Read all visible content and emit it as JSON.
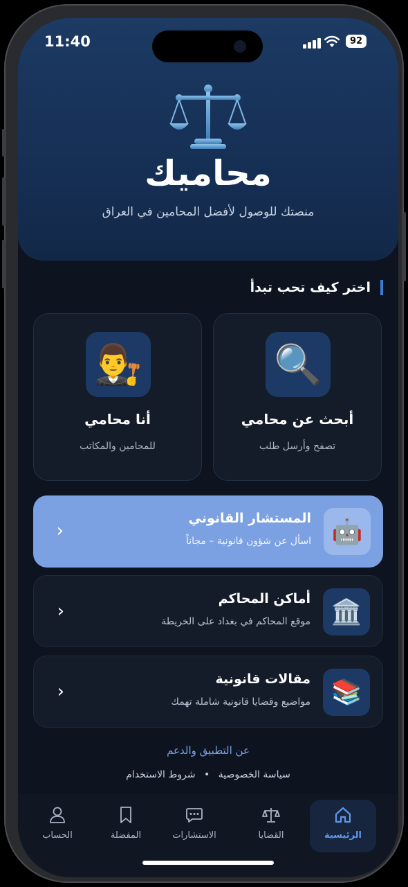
{
  "status": {
    "time": "11:40",
    "battery": "92"
  },
  "hero": {
    "title": "محاميك",
    "subtitle": "منصتك للوصول لأفضل المحامين في العراق",
    "icon": "scales-icon"
  },
  "section_title": "اختر كيف تحب تبدأ",
  "cards": [
    {
      "title": "أبحث عن محامي",
      "subtitle": "تصفح وأرسل طلب",
      "icon": "magnifier-icon",
      "emoji": "🔍"
    },
    {
      "title": "أنا محامي",
      "subtitle": "للمحامين والمكاتب",
      "icon": "judge-icon",
      "emoji": "👨‍⚖️"
    }
  ],
  "rows": [
    {
      "title": "المستشار القانوني",
      "subtitle": "اسأل عن شؤون قانونية – مجاناً",
      "icon": "robot-icon",
      "emoji": "🤖",
      "active": true
    },
    {
      "title": "أماكن المحاكم",
      "subtitle": "موقع المحاكم في بغداد على الخريطة",
      "icon": "courthouse-icon",
      "emoji": "🏛️",
      "active": false
    },
    {
      "title": "مقالات قانونية",
      "subtitle": "مواضيع وقضايا قانونية شاملة تهمك",
      "icon": "books-icon",
      "emoji": "📚",
      "active": false
    }
  ],
  "footer": {
    "about": "عن التطبيق والدعم",
    "privacy": "سياسة الخصوصية",
    "separator": "•",
    "terms": "شروط الاستخدام"
  },
  "tabs": [
    {
      "label": "الرئيسية",
      "icon": "home-icon",
      "active": true
    },
    {
      "label": "القضايا",
      "icon": "scales-icon",
      "active": false
    },
    {
      "label": "الاستشارات",
      "icon": "chat-icon",
      "active": false
    },
    {
      "label": "المفضلة",
      "icon": "bookmark-icon",
      "active": false
    },
    {
      "label": "الحساب",
      "icon": "user-icon",
      "active": false
    }
  ],
  "colors": {
    "accent": "#3b7bd6",
    "active_row": "#7ba1e3",
    "background": "#0d1420",
    "hero": "#1c3a63"
  }
}
